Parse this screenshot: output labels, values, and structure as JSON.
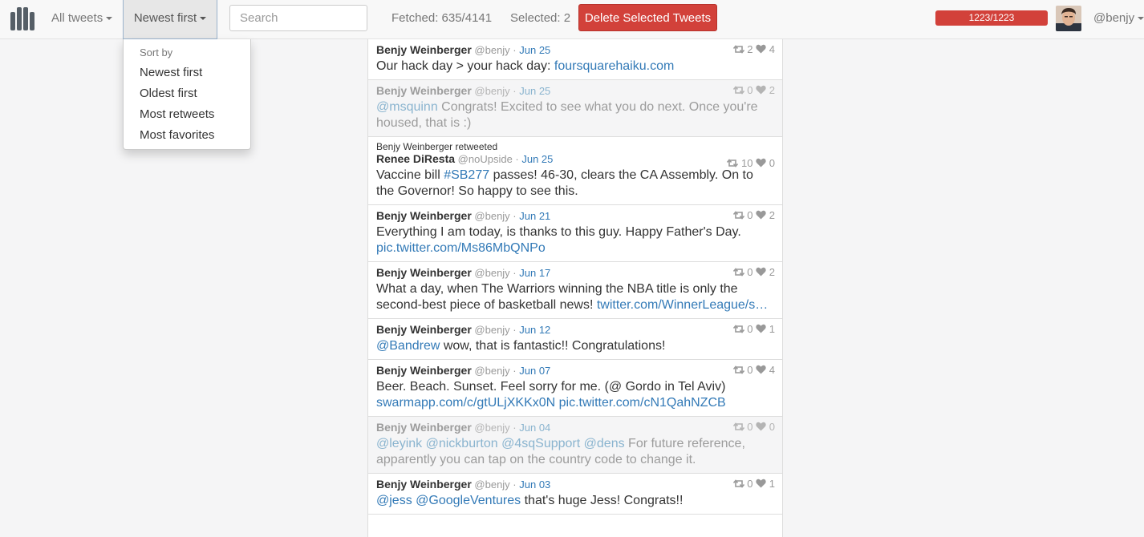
{
  "nav": {
    "all_tweets": "All tweets",
    "sort_label": "Newest first",
    "search_placeholder": "Search",
    "fetched": "Fetched: 635/4141",
    "selected": "Selected: 2",
    "delete_button": "Delete Selected Tweets",
    "progress_text": "1223/1223",
    "progress_fraction": 1.0,
    "username": "@benjy"
  },
  "sort_menu": {
    "header": "Sort by",
    "options": [
      "Newest first",
      "Oldest first",
      "Most retweets",
      "Most favorites"
    ]
  },
  "colors": {
    "accent": "#337ab7",
    "danger": "#d2413a"
  },
  "tweets": [
    {
      "name": "Benjy Weinberger",
      "handle": "@benjy",
      "date": "Jun 25",
      "retweets": "2",
      "likes": "4",
      "text": [
        [
          [
            "t",
            "Our hack day > your hack day: "
          ],
          [
            "l",
            "foursquarehaiku.com"
          ]
        ]
      ]
    },
    {
      "name": "Benjy Weinberger",
      "handle": "@benjy",
      "date": "Jun 25",
      "retweets": "0",
      "likes": "2",
      "selected": true,
      "text": [
        [
          [
            "l",
            "@msquinn"
          ],
          [
            "t",
            " Congrats! Excited to see what you do next. Once you're"
          ]
        ],
        [
          [
            "t",
            "housed, that is :)"
          ]
        ]
      ]
    },
    {
      "retweeted_by": "Benjy Weinberger retweeted",
      "name": "Renee DiResta",
      "handle": "@noUpside",
      "date": "Jun 25",
      "retweets": "10",
      "likes": "0",
      "text": [
        [
          [
            "t",
            "Vaccine bill "
          ],
          [
            "l",
            "#SB277"
          ],
          [
            "t",
            " passes! 46-30, clears the CA Assembly. On to"
          ]
        ],
        [
          [
            "t",
            "the Governor! So happy to see this."
          ]
        ]
      ]
    },
    {
      "name": "Benjy Weinberger",
      "handle": "@benjy",
      "date": "Jun 21",
      "retweets": "0",
      "likes": "2",
      "text": [
        [
          [
            "t",
            "Everything I am today, is thanks to this guy. Happy Father's Day."
          ]
        ],
        [
          [
            "l",
            "pic.twitter.com/Ms86MbQNPo"
          ]
        ]
      ]
    },
    {
      "name": "Benjy Weinberger",
      "handle": "@benjy",
      "date": "Jun 17",
      "retweets": "0",
      "likes": "2",
      "text": [
        [
          [
            "t",
            "What a day, when The Warriors winning the NBA title is only the"
          ]
        ],
        [
          [
            "t",
            "second-best piece of basketball news! "
          ],
          [
            "l",
            "twitter.com/WinnerLeague/s…"
          ]
        ]
      ]
    },
    {
      "name": "Benjy Weinberger",
      "handle": "@benjy",
      "date": "Jun 12",
      "retweets": "0",
      "likes": "1",
      "text": [
        [
          [
            "l",
            "@Bandrew"
          ],
          [
            "t",
            " wow, that is fantastic!! Congratulations!"
          ]
        ]
      ]
    },
    {
      "name": "Benjy Weinberger",
      "handle": "@benjy",
      "date": "Jun 07",
      "retweets": "0",
      "likes": "4",
      "text": [
        [
          [
            "t",
            "Beer. Beach. Sunset. Feel sorry for me. (@ Gordo in Tel Aviv)"
          ]
        ],
        [
          [
            "l",
            "swarmapp.com/c/gtULjXKKx0N"
          ],
          [
            "t",
            " "
          ],
          [
            "l",
            "pic.twitter.com/cN1QahNZCB"
          ]
        ]
      ]
    },
    {
      "name": "Benjy Weinberger",
      "handle": "@benjy",
      "date": "Jun 04",
      "retweets": "0",
      "likes": "0",
      "selected": true,
      "text": [
        [
          [
            "l",
            "@leyink"
          ],
          [
            "t",
            " "
          ],
          [
            "l",
            "@nickburton"
          ],
          [
            "t",
            " "
          ],
          [
            "l",
            "@4sqSupport"
          ],
          [
            "t",
            " "
          ],
          [
            "l",
            "@dens"
          ],
          [
            "t",
            " For future reference,"
          ]
        ],
        [
          [
            "t",
            "apparently you can tap on the country code to change it."
          ]
        ]
      ]
    },
    {
      "name": "Benjy Weinberger",
      "handle": "@benjy",
      "date": "Jun 03",
      "retweets": "0",
      "likes": "1",
      "text": [
        [
          [
            "l",
            "@jess"
          ],
          [
            "t",
            " "
          ],
          [
            "l",
            "@GoogleVentures"
          ],
          [
            "t",
            " that's huge Jess! Congrats!!"
          ]
        ]
      ]
    }
  ]
}
